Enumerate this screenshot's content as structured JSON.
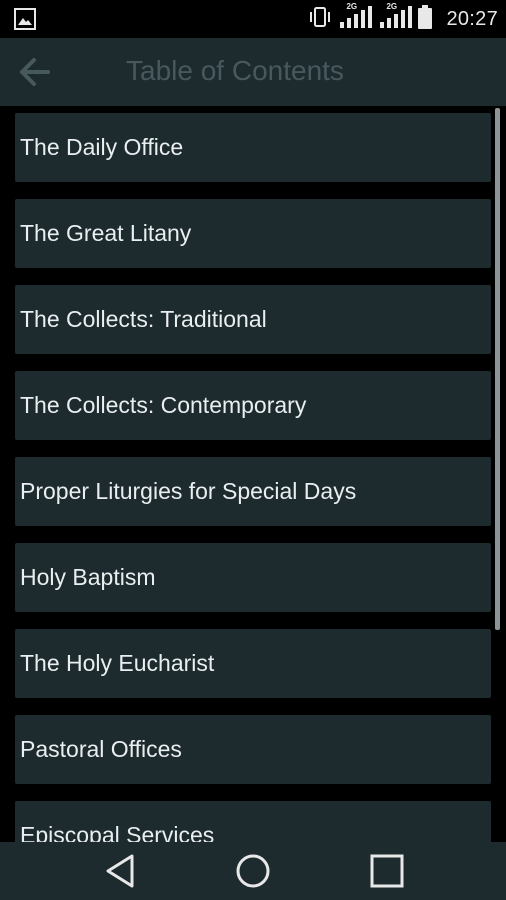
{
  "status_bar": {
    "time": "20:27",
    "network_label_1": "2G",
    "network_label_2": "2G"
  },
  "app_bar": {
    "title": "Table of Contents",
    "back_icon": "arrow-left-icon"
  },
  "toc": {
    "items": [
      {
        "label": "The Daily Office"
      },
      {
        "label": "The Great Litany"
      },
      {
        "label": "The Collects: Traditional"
      },
      {
        "label": "The Collects: Contemporary"
      },
      {
        "label": "Proper Liturgies for Special Days"
      },
      {
        "label": "Holy Baptism"
      },
      {
        "label": "The Holy Eucharist"
      },
      {
        "label": "Pastoral Offices"
      },
      {
        "label": "Episcopal Services"
      }
    ]
  },
  "nav_bar": {
    "back_icon": "triangle-back-icon",
    "home_icon": "circle-home-icon",
    "recents_icon": "square-recents-icon"
  },
  "colors": {
    "background": "#000000",
    "surface": "#1d2a2e",
    "title_text": "#48595e",
    "item_text": "#e9eef0"
  }
}
